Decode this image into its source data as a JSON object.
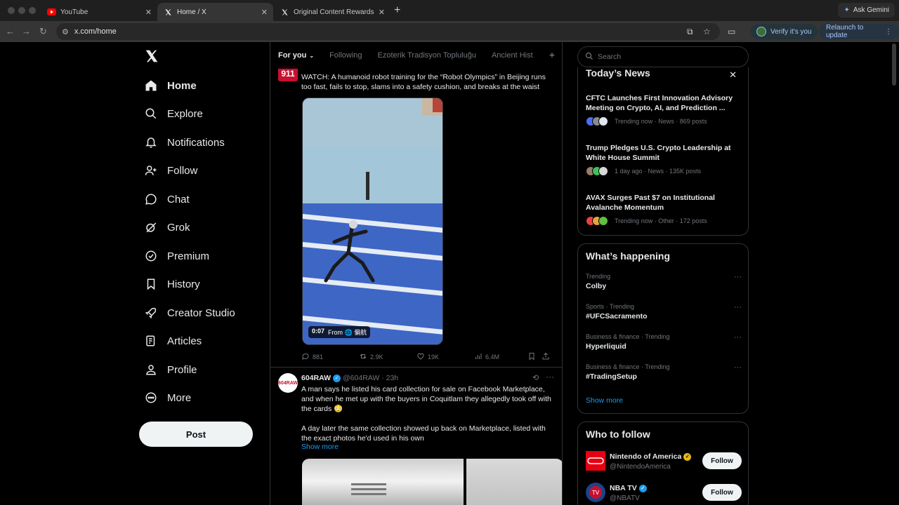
{
  "browser": {
    "tabs": [
      {
        "label": "YouTube",
        "icon": "youtube-icon"
      },
      {
        "label": "Home / X",
        "icon": "x-icon"
      },
      {
        "label": "Original Content Rewards Ap",
        "icon": "x-icon"
      }
    ],
    "ask_gemini": "Ask Gemini",
    "url": "x.com/home",
    "verify": "Verify it's you",
    "relaunch": "Relaunch to update"
  },
  "sidebar": {
    "items": [
      {
        "label": "Home",
        "icon": "home-icon"
      },
      {
        "label": "Explore",
        "icon": "search-icon"
      },
      {
        "label": "Notifications",
        "icon": "bell-icon"
      },
      {
        "label": "Follow",
        "icon": "follow-icon"
      },
      {
        "label": "Chat",
        "icon": "chat-icon"
      },
      {
        "label": "Grok",
        "icon": "grok-icon"
      },
      {
        "label": "Premium",
        "icon": "premium-icon"
      },
      {
        "label": "History",
        "icon": "bookmark-icon"
      },
      {
        "label": "Creator Studio",
        "icon": "rocket-icon"
      },
      {
        "label": "Articles",
        "icon": "articles-icon"
      },
      {
        "label": "Profile",
        "icon": "person-icon"
      },
      {
        "label": "More",
        "icon": "more-circle-icon"
      }
    ],
    "post_label": "Post"
  },
  "feed": {
    "tabs": [
      "For you",
      "Following",
      "Ezoterik Tradisyon Topluluğu",
      "Ancient Hist"
    ],
    "tweet1": {
      "avatar_text": "911",
      "text": "WATCH: A humanoid robot training for the “Robot Olympics” in Beijing runs too fast, fails to stop, slams into a safety cushion, and breaks at the waist",
      "video_duration": "0:07",
      "video_from": "From 🌐 偏航",
      "replies": "881",
      "reposts": "2.9K",
      "likes": "19K",
      "views": "6.4M"
    },
    "tweet2": {
      "avatar_text": "604RAW",
      "name": "604RAW",
      "handle": "@604RAW · 23h",
      "para1": "A man says he listed his card collection for sale on Facebook Marketplace, and when he met up with the buyers in Coquitlam they allegedly took off with the cards 😳",
      "para2": "A day later the same collection showed up back on Marketplace, listed with the exact photos he'd used in his own",
      "show_more": "Show more"
    }
  },
  "right": {
    "search_placeholder": "Search",
    "todays_news": {
      "title": "Today’s News",
      "items": [
        {
          "title": "CFTC Launches First Innovation Advisory Meeting on Crypto, AI, and Prediction ...",
          "meta": "Trending now · News · 869 posts"
        },
        {
          "title": "Trump Pledges U.S. Crypto Leadership at White House Summit",
          "meta": "1 day ago · News · 135K posts"
        },
        {
          "title": "AVAX Surges Past $7 on Institutional Avalanche Momentum",
          "meta": "Trending now · Other · 172 posts"
        }
      ]
    },
    "whats_happening": {
      "title": "What’s happening",
      "items": [
        {
          "meta": "Trending",
          "name": "Colby"
        },
        {
          "meta": "Sports · Trending",
          "name": "#UFCSacramento"
        },
        {
          "meta": "Business & finance · Trending",
          "name": "Hyperliquid"
        },
        {
          "meta": "Business & finance · Trending",
          "name": "#TradingSetup"
        }
      ],
      "show_more": "Show more"
    },
    "who_to_follow": {
      "title": "Who to follow",
      "items": [
        {
          "name": "Nintendo of America",
          "handle": "@NintendoAmerica",
          "button": "Follow"
        },
        {
          "name": "NBA TV",
          "handle": "@NBATV",
          "button": "Follow"
        }
      ]
    }
  },
  "colors": {
    "accent": "#1d9bf0",
    "background": "#000000",
    "border": "#2f3336"
  }
}
